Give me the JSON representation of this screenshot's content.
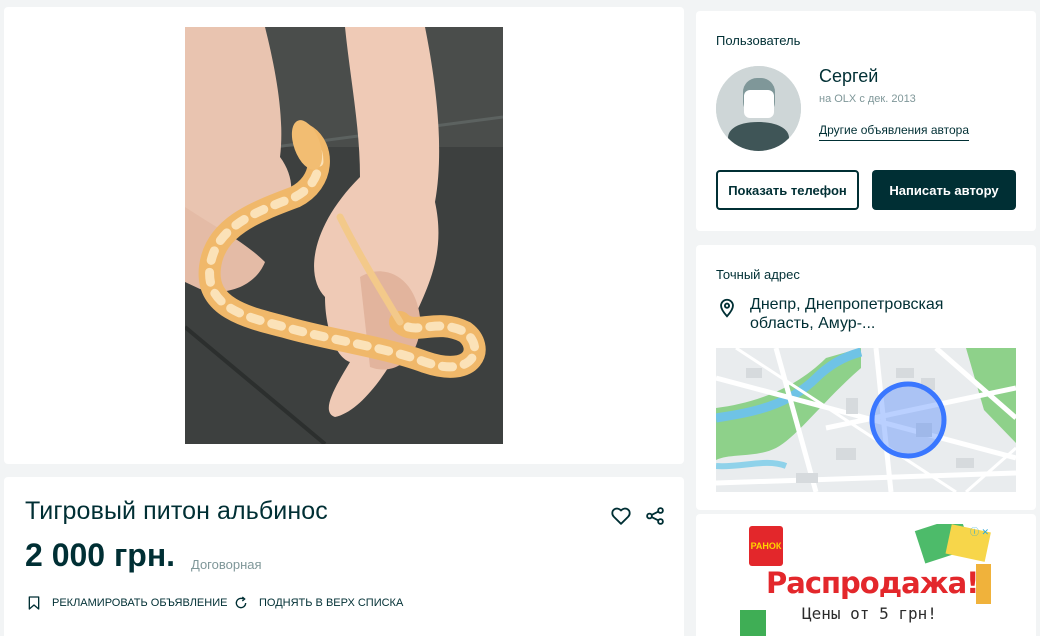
{
  "listing": {
    "title": "Тигровый питон альбинос",
    "price": "2 000 грн.",
    "negotiable": "Договорная",
    "actions": {
      "promote": "РЕКЛАМИРОВАТЬ ОБЪЯВЛЕНИЕ",
      "bump": "ПОДНЯТЬ В ВЕРХ СПИСКА"
    },
    "icons": {
      "favorite": "heart-icon",
      "share": "share-icon",
      "promote": "bookmark-icon",
      "bump": "refresh-icon"
    }
  },
  "user": {
    "section_label": "Пользователь",
    "name": "Сергей",
    "since": "на OLX с дек. 2013",
    "other_ads": "Другие объявления автора",
    "show_phone": "Показать телефон",
    "message": "Написать автору"
  },
  "address": {
    "section_label": "Точный адрес",
    "text": "Днепр, Днепропетровская область, Амур-...",
    "icon": "location-pin-icon"
  },
  "banner": {
    "logo": "РАНОК",
    "headline": "Распродажа!",
    "subline": "Цены от 5 грн!"
  },
  "colors": {
    "primary": "#002f34",
    "muted": "#7f9799",
    "background": "#f2f4f5",
    "map_marker": "#3a77ff",
    "banner_red": "#e3272b"
  }
}
